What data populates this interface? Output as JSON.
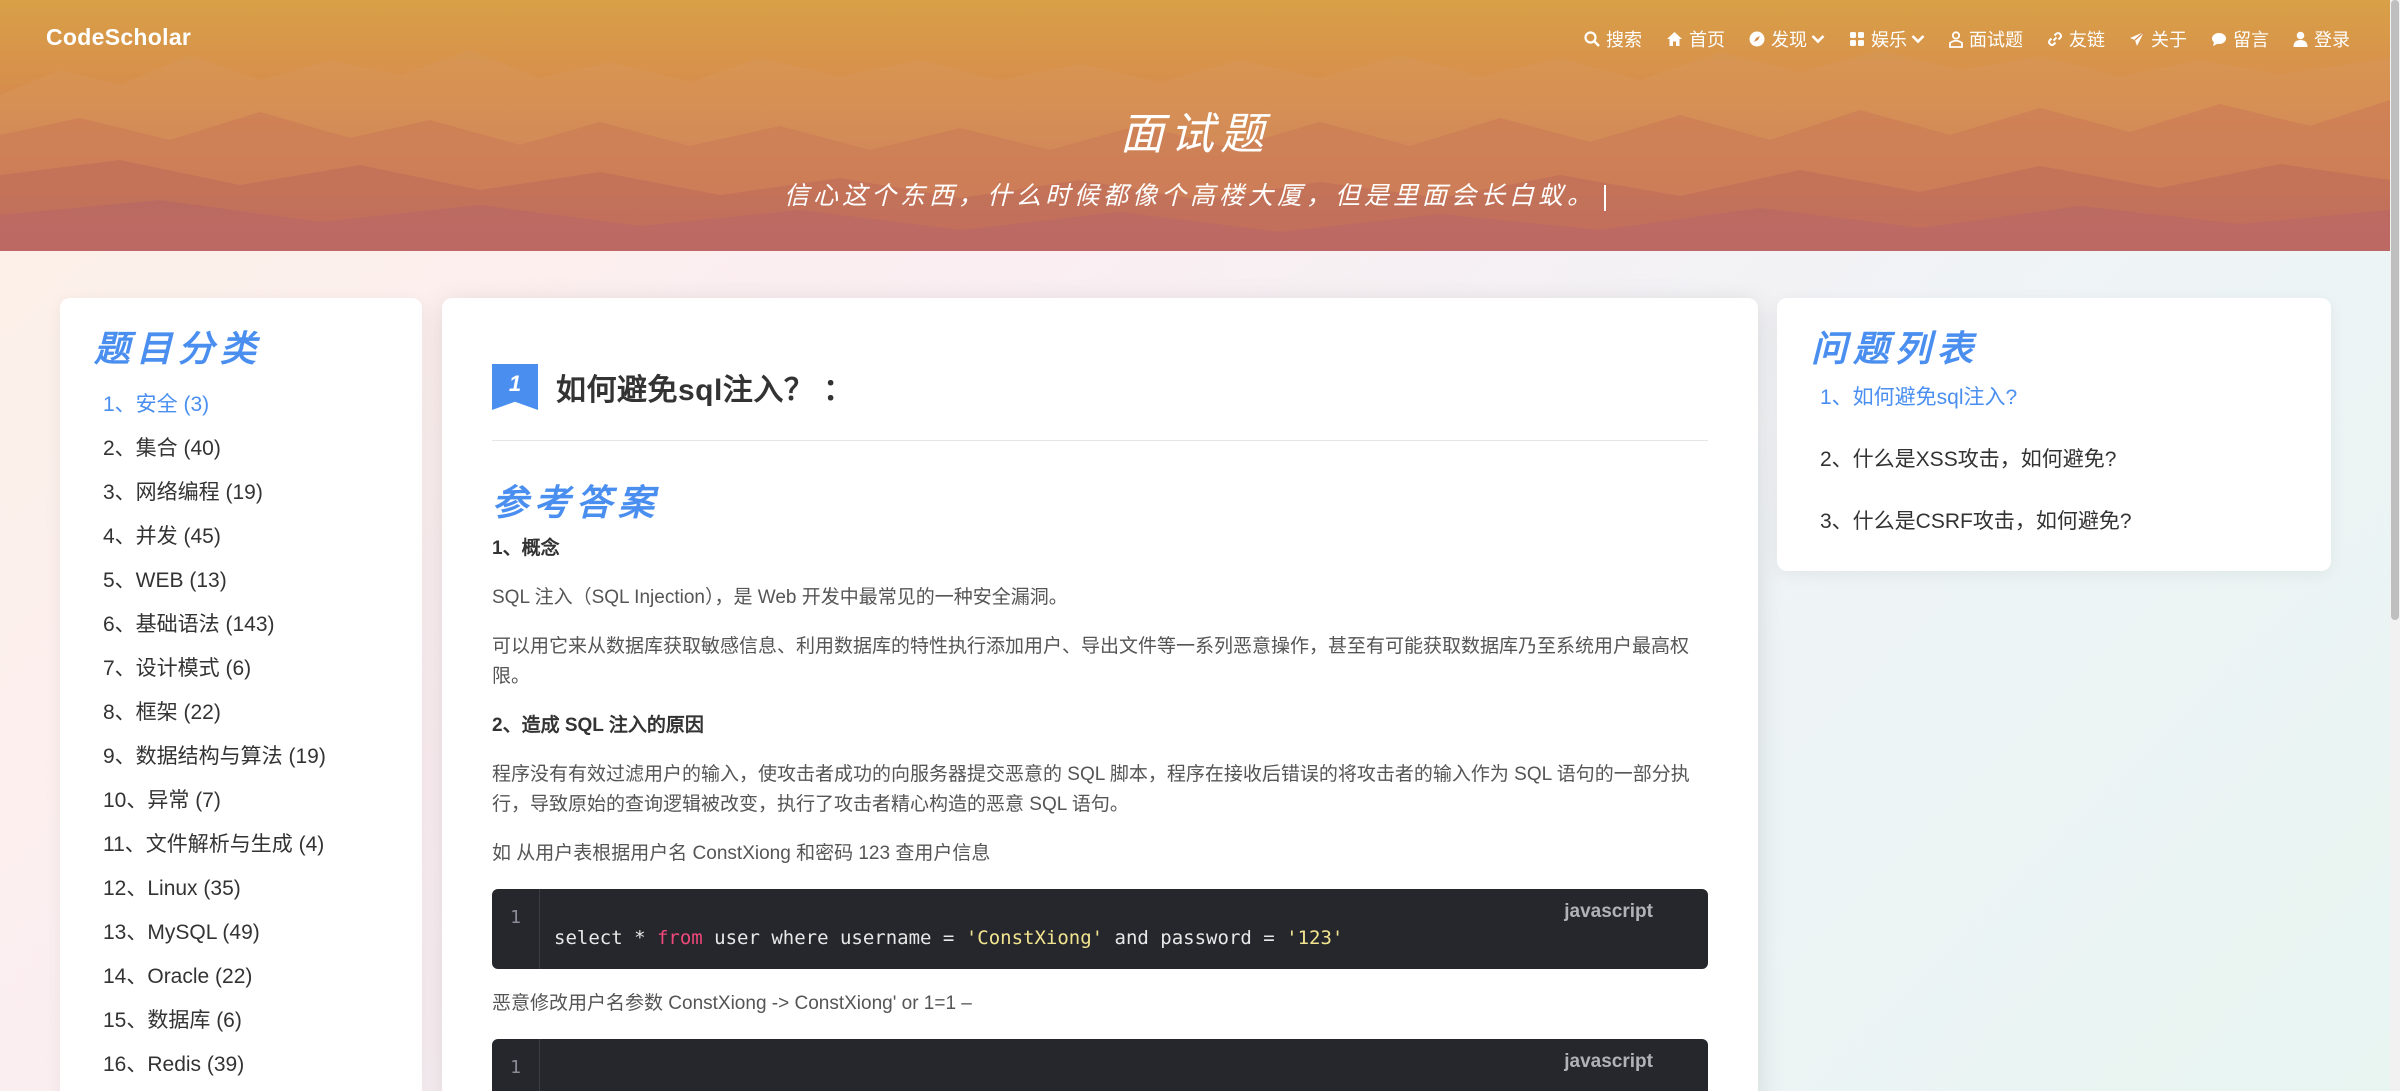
{
  "brand": "CodeScholar",
  "nav": [
    {
      "label": "搜索",
      "icon": "search-icon"
    },
    {
      "label": "首页",
      "icon": "home-icon"
    },
    {
      "label": "发现",
      "icon": "compass-icon",
      "dropdown": true
    },
    {
      "label": "娱乐",
      "icon": "grid-icon",
      "dropdown": true
    },
    {
      "label": "面试题",
      "icon": "person-icon"
    },
    {
      "label": "友链",
      "icon": "link-icon"
    },
    {
      "label": "关于",
      "icon": "paper-plane-icon"
    },
    {
      "label": "留言",
      "icon": "chat-icon"
    },
    {
      "label": "登录",
      "icon": "user-icon"
    }
  ],
  "hero": {
    "title": "面试题",
    "subtitle": "信心这个东西，什么时候都像个高楼大厦，但是里面会长白蚁。"
  },
  "categories": {
    "title": "题目分类",
    "items": [
      "1、安全 (3)",
      "2、集合 (40)",
      "3、网络编程 (19)",
      "4、并发 (45)",
      "5、WEB (13)",
      "6、基础语法 (143)",
      "7、设计模式 (6)",
      "8、框架 (22)",
      "9、数据结构与算法 (19)",
      "10、异常 (7)",
      "11、文件解析与生成 (4)",
      "12、Linux (35)",
      "13、MySQL (49)",
      "14、Oracle (22)",
      "15、数据库 (6)",
      "16、Redis (39)"
    ],
    "active_index": 0
  },
  "question": {
    "number": "1",
    "title": "如何避免sql注入？ ："
  },
  "answer": {
    "heading": "参考答案",
    "section1_title": "1、概念",
    "p1": "SQL 注入（SQL Injection），是 Web 开发中最常见的一种安全漏洞。",
    "p2": "可以用它来从数据库获取敏感信息、利用数据库的特性执行添加用户、导出文件等一系列恶意操作，甚至有可能获取数据库乃至系统用户最高权限。",
    "section2_title": "2、造成 SQL 注入的原因",
    "p3": "程序没有有效过滤用户的输入，使攻击者成功的向服务器提交恶意的 SQL 脚本，程序在接收后错误的将攻击者的输入作为 SQL 语句的一部分执行，导致原始的查询逻辑被改变，执行了攻击者精心构造的恶意 SQL 语句。",
    "p4": "如 从用户表根据用户名 ConstXiong 和密码 123 查用户信息",
    "code1": {
      "lang": "javascript",
      "line": "1",
      "tokens": {
        "a": "select * ",
        "kw": "from",
        "b": " user where username = ",
        "s1": "'ConstXiong'",
        "c": " and password = ",
        "s2": "'123'"
      }
    },
    "p5": "恶意修改用户名参数 ConstXiong -> ConstXiong' or 1=1 –",
    "code2": {
      "lang": "javascript",
      "line": "1"
    }
  },
  "questions": {
    "title": "问题列表",
    "items": [
      "1、如何避免sql注入?",
      "2、什么是XSS攻击，如何避免?",
      "3、什么是CSRF攻击，如何避免?"
    ],
    "active_index": 0
  },
  "colors": {
    "accent": "#4a8ff0",
    "code_bg": "#25272d",
    "keyword": "#f0487a",
    "string": "#f3e58f"
  }
}
